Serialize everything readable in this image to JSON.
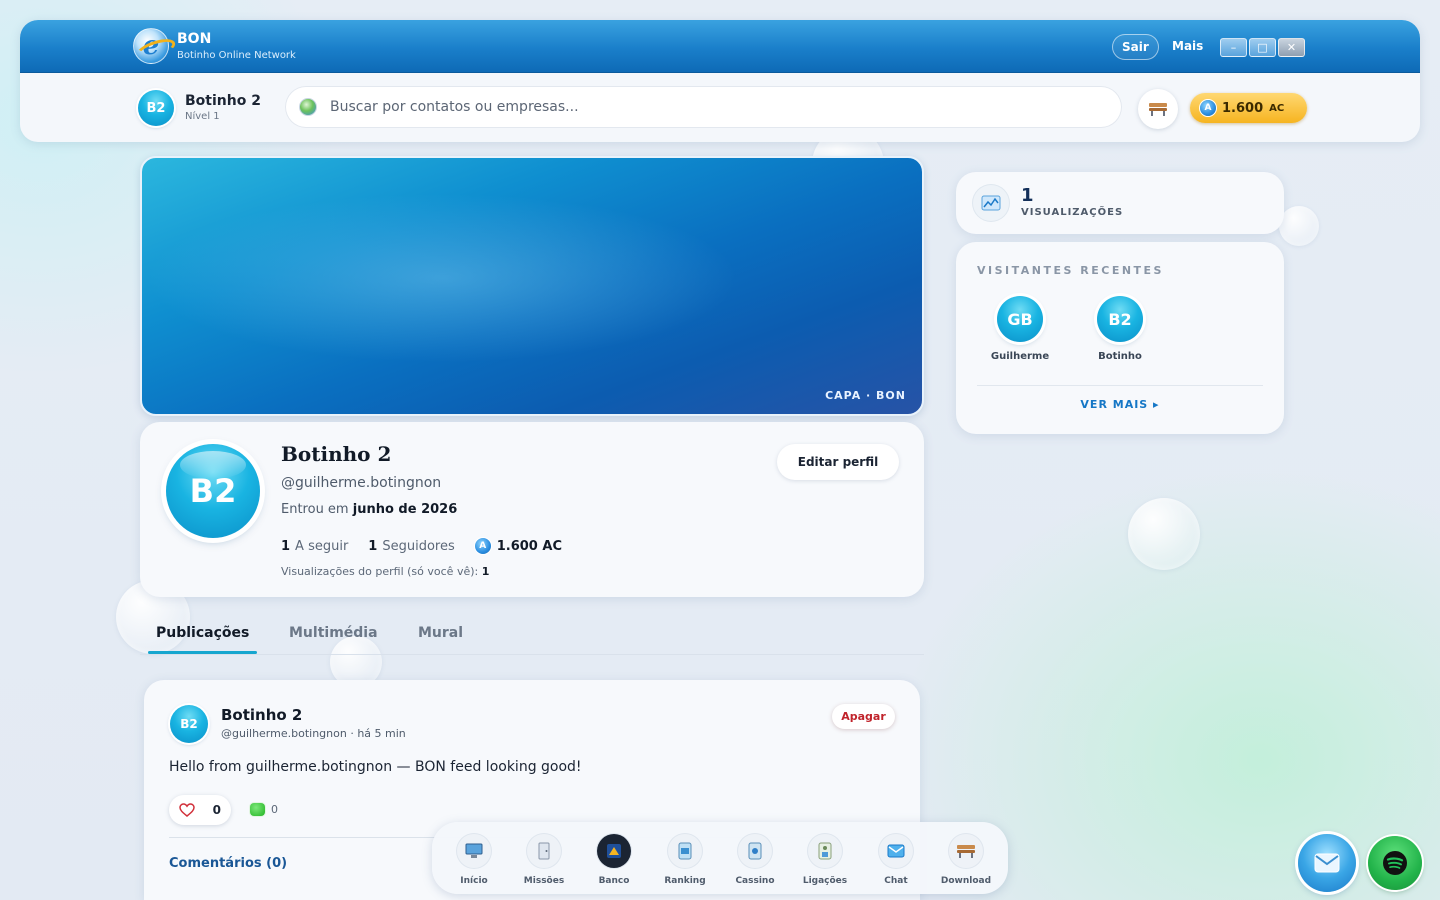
{
  "app": {
    "title": "BON",
    "subtitle": "Botinho Online Network",
    "sair_label": "Sair",
    "mais_label": "Mais",
    "window_controls": {
      "minimize": "–",
      "maximize": "□",
      "close": "✕"
    }
  },
  "toolbar": {
    "user_initials": "B2",
    "user_name": "Botinho 2",
    "user_level": "Nível 1",
    "search_placeholder": "Buscar por contatos ou empresas...",
    "coins_amount": "1.600",
    "coins_unit": "AC",
    "coin_letter": "A"
  },
  "cover": {
    "label": "CAPA · BON"
  },
  "profile": {
    "initials": "B2",
    "name": "Botinho 2",
    "handle": "@guilherme.botingnon",
    "joined_prefix": "Entrou em",
    "joined_date": "junho de 2026",
    "following_count": "1",
    "following_label": "A seguir",
    "followers_count": "1",
    "followers_label": "Seguidores",
    "coins": "1.600 AC",
    "views_note": "Visualizações do perfil (só você vê):",
    "views_count": "1",
    "edit_label": "Editar perfil"
  },
  "tabs": [
    {
      "label": "Publicações",
      "active": true
    },
    {
      "label": "Multimédia",
      "active": false
    },
    {
      "label": "Mural",
      "active": false
    }
  ],
  "post": {
    "author_initials": "B2",
    "author": "Botinho 2",
    "meta": "@guilherme.botingnon · há 5 min",
    "delete_label": "Apagar",
    "text": "Hello from guilherme.botingnon — BON feed looking good!",
    "likes": "0",
    "comments": "0",
    "comments_title": "Comentários (0)"
  },
  "sidebar": {
    "views_count": "1",
    "views_label": "VISUALIZAÇÕES",
    "visitors_title": "VISITANTES RECENTES",
    "visitors": [
      {
        "initials": "GB",
        "name": "Guilherme"
      },
      {
        "initials": "B2",
        "name": "Botinho"
      }
    ],
    "ver_mais": "VER MAIS ▸"
  },
  "dock": [
    {
      "label": "Início",
      "icon": "computer-icon"
    },
    {
      "label": "Missões",
      "icon": "door-icon"
    },
    {
      "label": "Banco",
      "icon": "bank-icon"
    },
    {
      "label": "Ranking",
      "icon": "ranking-icon"
    },
    {
      "label": "Cassino",
      "icon": "casino-icon"
    },
    {
      "label": "Ligações",
      "icon": "calls-icon"
    },
    {
      "label": "Chat",
      "icon": "mail-icon"
    },
    {
      "label": "Download",
      "icon": "bench-icon"
    }
  ],
  "colors": {
    "titlebar": "#1a7fca",
    "accent": "#16a6cf",
    "coins": "#f6b420",
    "danger": "#c0232b",
    "link": "#1577c6"
  }
}
